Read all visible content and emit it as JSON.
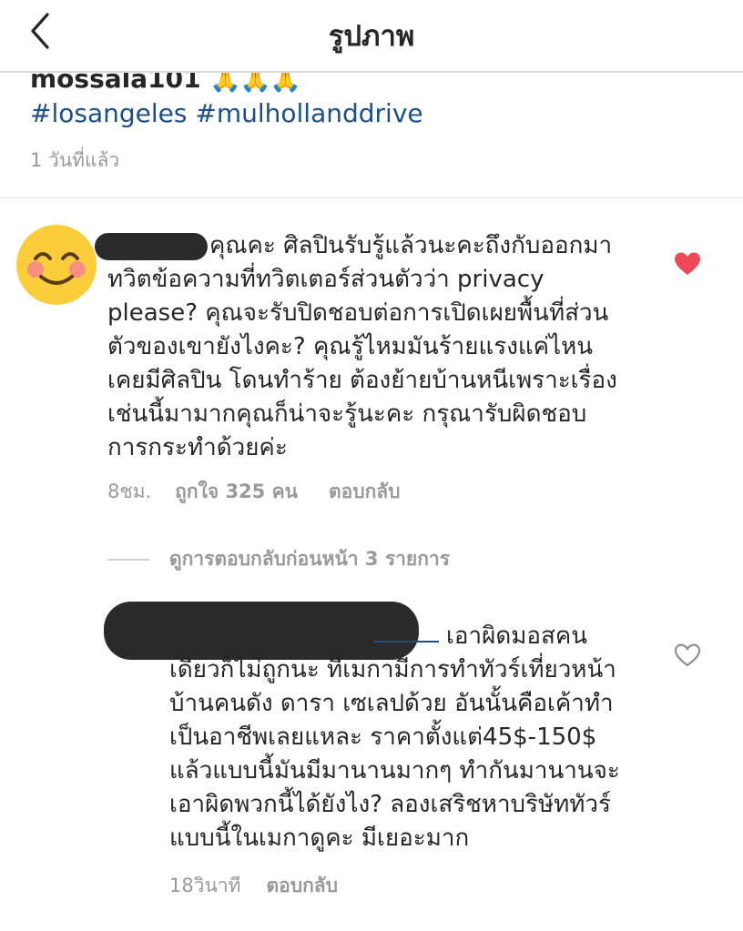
{
  "header": {
    "title": "รูปภาพ",
    "back_icon": "chevron-left-icon"
  },
  "caption": {
    "username": "mossala101",
    "emoji": "🙏🙏🙏",
    "hashtags": [
      "#losangeles",
      "#mulhollanddrive"
    ],
    "time": "1 วันที่แล้ว"
  },
  "comments": [
    {
      "avatar_icon": "smiling-face-icon",
      "lines": [
        "คุณคะ ศิลปินรับรู้แล้วนะคะถึงกับออกมา",
        "ทวิตข้อความที่ทวิตเตอร์ส่วนตัวว่า privacy",
        "please? คุณจะรับปิดชอบต่อการเปิดเผยพื้นที่ส่วน",
        "ตัวของเขายังไงคะ? คุณรู้ไหมมันร้ายแรงแค่ไหน",
        "เคยมีศิลปิน โดนทำร้าย ต้องย้ายบ้านหนีเพราะเรื่อง",
        "เช่นนี้มามากคุณก็น่าจะรู้นะคะ กรุณารับผิดชอบ",
        "การกระทำด้วยค่ะ"
      ],
      "time": "8ชม.",
      "likes": "ถูกใจ 325 คน",
      "reply_label": "ตอบกลับ",
      "liked": true,
      "like_color": "#ed4956"
    },
    {
      "lines": [
        "เอาผิดมอสคน",
        "เดียวก็ไม่ถูกนะ ที่เมกามีการทำทัวร์เที่ยวหน้า",
        "บ้านคนดัง ดารา เซเลปด้วย อันนั้นคือเค้าทำ",
        "เป็นอาชีพเลยแหละ ราคาตั้งแต่45$-150$",
        "แล้วแบบนี้มันมีมานานมากๆ ทำกันมานานจะ",
        "เอาผิดพวกนี้ได้ยังไง? ลองเสริชหาบริษัททัวร์",
        "แบบนี้ในเมกาดูคะ มีเยอะมาก"
      ],
      "time": "18วินาที",
      "reply_label": "ตอบกลับ",
      "liked": false
    }
  ],
  "view_replies": "ดูการตอบกลับก่อนหน้า 3 รายการ",
  "colors": {
    "hashtag": "#1d4f85",
    "muted": "#999999",
    "text": "#262626",
    "like": "#ed4956",
    "redaction": "#2b2b2b"
  }
}
